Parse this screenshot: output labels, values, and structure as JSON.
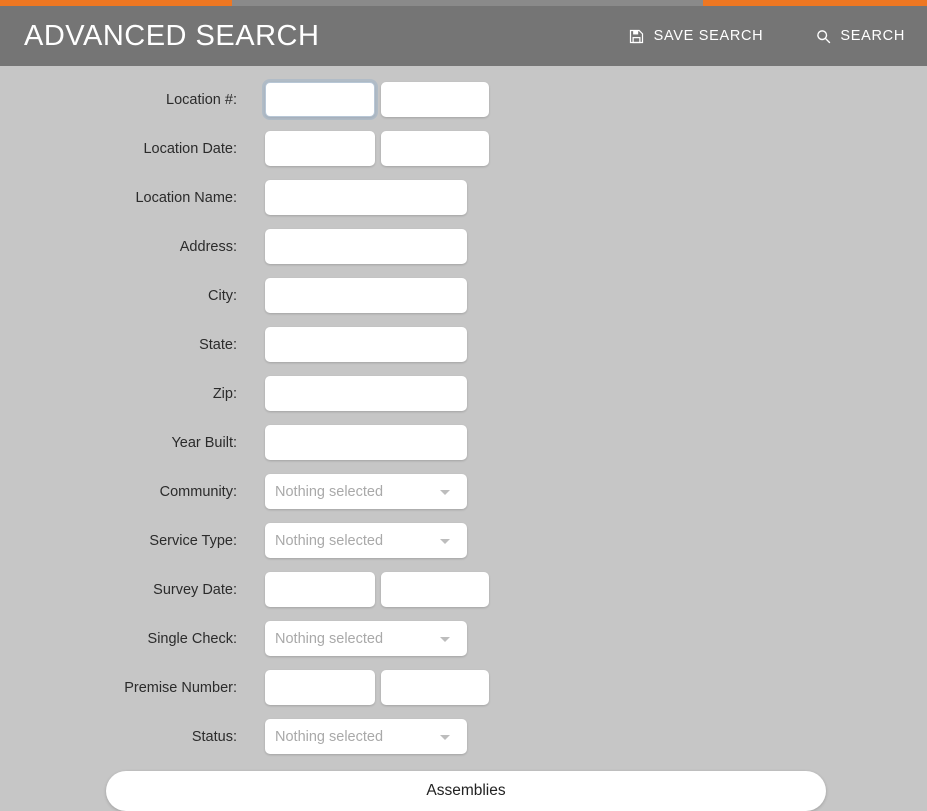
{
  "header": {
    "title": "ADVANCED SEARCH",
    "actions": [
      {
        "label": "SAVE SEARCH",
        "icon": "save-icon"
      },
      {
        "label": "SEARCH",
        "icon": "search-icon"
      }
    ]
  },
  "theme": {
    "accent": "#ee7722",
    "header_bg": "#757575",
    "body_bg": "#c6c6c6",
    "field_bg": "#ffffff",
    "placeholder": "#a9a9a9"
  },
  "form": {
    "rows": [
      {
        "label": "Location #:",
        "type": "text-pair",
        "value_a": "",
        "value_b": "",
        "focused": true
      },
      {
        "label": "Location Date:",
        "type": "text-pair",
        "value_a": "",
        "value_b": "",
        "focused": false
      },
      {
        "label": "Location Name:",
        "type": "text-single",
        "value": ""
      },
      {
        "label": "Address:",
        "type": "text-single",
        "value": ""
      },
      {
        "label": "City:",
        "type": "text-single",
        "value": ""
      },
      {
        "label": "State:",
        "type": "text-single",
        "value": ""
      },
      {
        "label": "Zip:",
        "type": "text-single",
        "value": ""
      },
      {
        "label": "Year Built:",
        "type": "text-single",
        "value": ""
      },
      {
        "label": "Community:",
        "type": "select",
        "value": "Nothing selected"
      },
      {
        "label": "Service Type:",
        "type": "select",
        "value": "Nothing selected"
      },
      {
        "label": "Survey Date:",
        "type": "text-pair",
        "value_a": "",
        "value_b": "",
        "focused": false
      },
      {
        "label": "Single Check:",
        "type": "select",
        "value": "Nothing selected"
      },
      {
        "label": "Premise Number:",
        "type": "text-pair",
        "value_a": "",
        "value_b": "",
        "focused": false
      },
      {
        "label": "Status:",
        "type": "select",
        "value": "Nothing selected"
      }
    ]
  },
  "footer": {
    "assemblies_label": "Assemblies"
  }
}
